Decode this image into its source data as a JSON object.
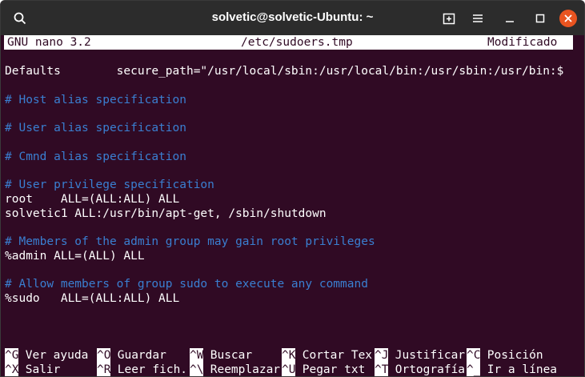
{
  "titlebar": {
    "title": "solvetic@solvetic-Ubuntu: ~",
    "search_icon": "search-icon",
    "new_tab_icon": "new-tab-icon",
    "menu_icon": "hamburger-menu-icon",
    "minimize_icon": "minimize-icon",
    "maximize_icon": "maximize-icon",
    "close_icon": "close-icon",
    "close_color": "#e95420"
  },
  "nano": {
    "version": "GNU nano 3.2",
    "filename": "/etc/sudoers.tmp",
    "status": "Modificado"
  },
  "lines": [
    {
      "text": "Defaults        secure_path=\"/usr/local/sbin:/usr/local/bin:/usr/sbin:/usr/bin:$",
      "comment": false
    },
    {
      "text": "# Host alias specification",
      "comment": true
    },
    {
      "text": "# User alias specification",
      "comment": true
    },
    {
      "text": "# Cmnd alias specification",
      "comment": true
    },
    {
      "text": "# User privilege specification",
      "comment": true
    },
    {
      "text": "root    ALL=(ALL:ALL) ALL",
      "comment": false
    },
    {
      "text": "solvetic1 ALL:/usr/bin/apt-get, /sbin/shutdown",
      "comment": false
    },
    {
      "text": "# Members of the admin group may gain root privileges",
      "comment": true
    },
    {
      "text": "%admin ALL=(ALL) ALL",
      "comment": false
    },
    {
      "text": "# Allow members of group sudo to execute any command",
      "comment": true
    },
    {
      "text": "%sudo   ALL=(ALL:ALL) ALL",
      "comment": false
    }
  ],
  "shortcuts_row1": [
    {
      "key": "^G",
      "label": " Ver ayuda"
    },
    {
      "key": "^O",
      "label": " Guardar"
    },
    {
      "key": "^W",
      "label": " Buscar"
    },
    {
      "key": "^K",
      "label": " Cortar Tex"
    },
    {
      "key": "^J",
      "label": " Justificar"
    },
    {
      "key": "^C",
      "label": " Posición"
    }
  ],
  "shortcuts_row2": [
    {
      "key": "^X",
      "label": " Salir"
    },
    {
      "key": "^R",
      "label": " Leer fich."
    },
    {
      "key": "^\\",
      "label": " Reemplazar"
    },
    {
      "key": "^U",
      "label": " Pegar txt"
    },
    {
      "key": "^T",
      "label": " Ortografía"
    },
    {
      "key": "^_",
      "label": " Ir a línea"
    }
  ],
  "colors": {
    "terminal_bg": "#300a24",
    "comment": "#3a7fd1",
    "text": "#ffffff"
  }
}
